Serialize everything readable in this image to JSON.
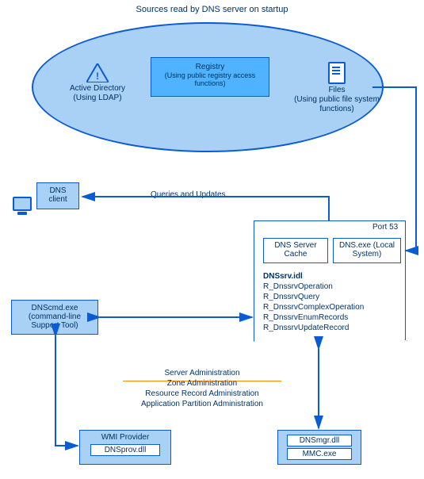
{
  "title": "Sources read by DNS server on startup",
  "sources": {
    "active_directory": {
      "name": "Active Directory",
      "detail": "(Using LDAP)"
    },
    "registry": {
      "name": "Registry",
      "detail": "(Using public registry access functions)"
    },
    "files": {
      "name": "Files",
      "detail": "(Using public file system functions)"
    }
  },
  "dns_client": {
    "label1": "DNS",
    "label2": "client"
  },
  "queries_label": "Queries and Updates",
  "server": {
    "port_label": "Port 53",
    "cache": "DNS Server Cache",
    "exe": "DNS.exe (Local System)",
    "idl_title": "DNSsrv.idl",
    "idl_ops": [
      "R_DnssrvOperation",
      "R_DnssrvQuery",
      "R_DnssrvComplexOperation",
      "R_DnssrvEnumRecords",
      "R_DnssrvUpdateRecord"
    ]
  },
  "dnscmd": {
    "line1": "DNScmd.exe",
    "line2": "(command-line",
    "line3": "Support Tool)"
  },
  "admin": {
    "line1": "Server Administration",
    "line2": "Zone Administration",
    "line3": "Resource Record Administration",
    "line4": "Application Partition Administration"
  },
  "wmi": {
    "title": "WMI Provider",
    "dll": "DNSprov.dll"
  },
  "mmc": {
    "dll": "DNSmgr.dll",
    "exe": "MMC.exe"
  }
}
